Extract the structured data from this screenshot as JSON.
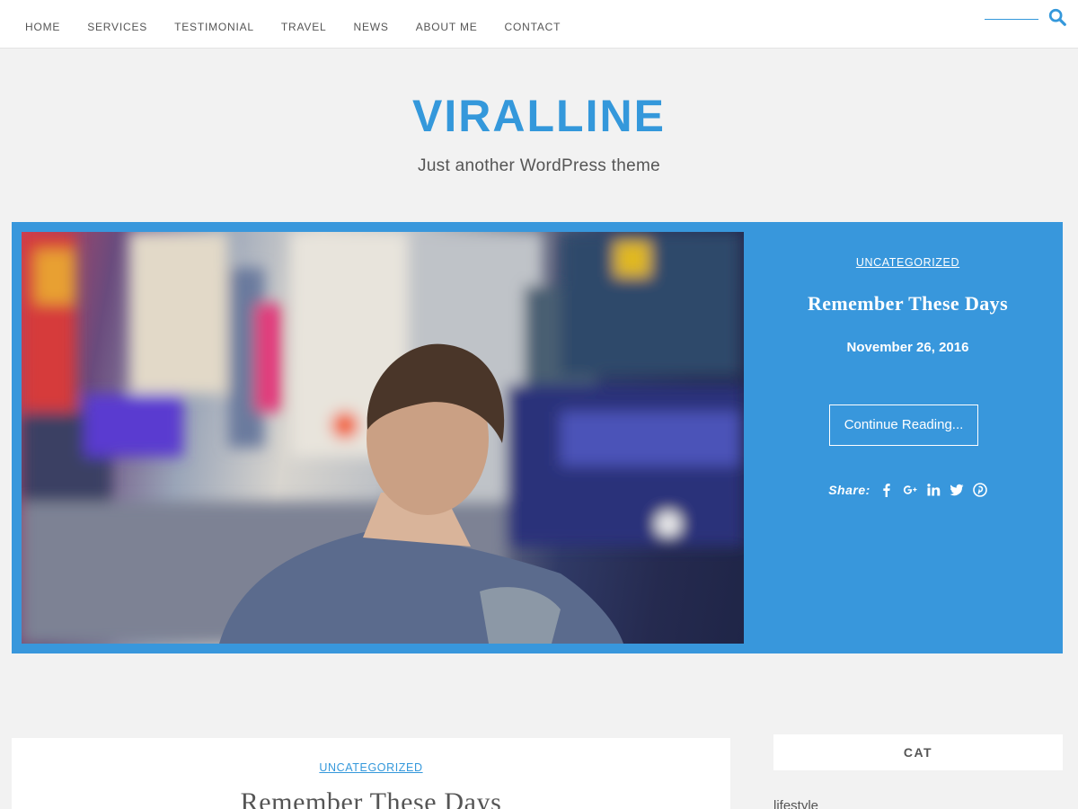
{
  "nav": {
    "items": [
      "HOME",
      "SERVICES",
      "TESTIMONIAL",
      "TRAVEL",
      "NEWS",
      "ABOUT ME",
      "CONTACT"
    ],
    "search_icon": "search-icon",
    "accent": "#3498db"
  },
  "header": {
    "title": "VIRALLINE",
    "description": "Just another WordPress theme"
  },
  "featured": {
    "category": "UNCATEGORIZED",
    "title": "Remember These Days",
    "date": "November 26, 2016",
    "button": "Continue Reading...",
    "share_label": "Share:",
    "share_icons": [
      "facebook-icon",
      "google-plus-icon",
      "linkedin-icon",
      "twitter-icon",
      "pinterest-icon"
    ],
    "background": "#3897dc"
  },
  "post": {
    "category": "UNCATEGORIZED",
    "title": "Remember These Days"
  },
  "sidebar": {
    "widget_title": "CAT",
    "first_item": "lifestyle"
  }
}
